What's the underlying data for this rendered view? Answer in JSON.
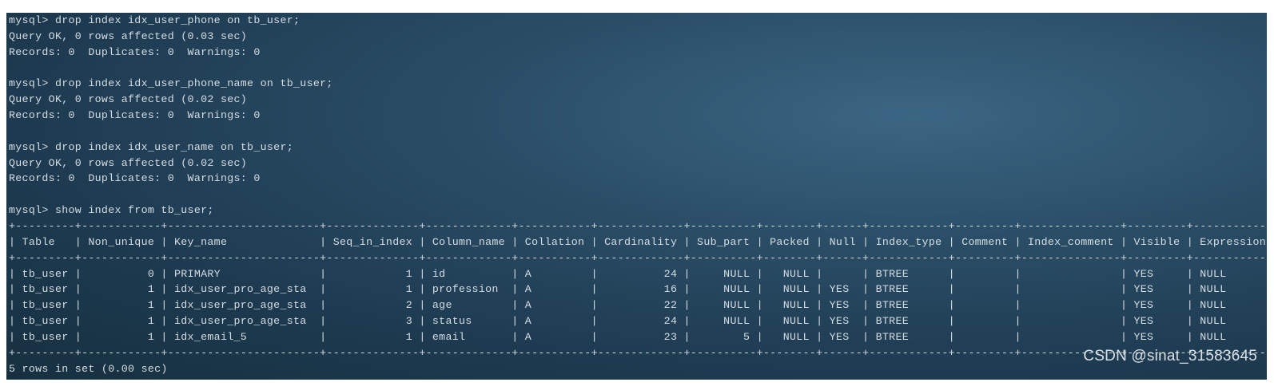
{
  "terminal": {
    "lines": [
      "mysql> drop index idx_user_phone on tb_user;",
      "Query OK, 0 rows affected (0.03 sec)",
      "Records: 0  Duplicates: 0  Warnings: 0",
      "",
      "mysql> drop index idx_user_phone_name on tb_user;",
      "Query OK, 0 rows affected (0.02 sec)",
      "Records: 0  Duplicates: 0  Warnings: 0",
      "",
      "mysql> drop index idx_user_name on tb_user;",
      "Query OK, 0 rows affected (0.02 sec)",
      "Records: 0  Duplicates: 0  Warnings: 0",
      "",
      "mysql> show index from tb_user;",
      "+---------+------------+-----------------------+--------------+-------------+-----------+-------------+----------+--------+------+------------+---------+---------------+---------+------------+",
      "| Table   | Non_unique | Key_name              | Seq_in_index | Column_name | Collation | Cardinality | Sub_part | Packed | Null | Index_type | Comment | Index_comment | Visible | Expression |",
      "+---------+------------+-----------------------+--------------+-------------+-----------+-------------+----------+--------+------+------------+---------+---------------+---------+------------+",
      "| tb_user |          0 | PRIMARY               |            1 | id          | A         |          24 |     NULL |   NULL |      | BTREE      |         |               | YES     | NULL       |",
      "| tb_user |          1 | idx_user_pro_age_sta  |            1 | profession  | A         |          16 |     NULL |   NULL | YES  | BTREE      |         |               | YES     | NULL       |",
      "| tb_user |          1 | idx_user_pro_age_sta  |            2 | age         | A         |          22 |     NULL |   NULL | YES  | BTREE      |         |               | YES     | NULL       |",
      "| tb_user |          1 | idx_user_pro_age_sta  |            3 | status      | A         |          24 |     NULL |   NULL | YES  | BTREE      |         |               | YES     | NULL       |",
      "| tb_user |          1 | idx_email_5           |            1 | email       | A         |          23 |        5 |   NULL | YES  | BTREE      |         |               | YES     | NULL       |",
      "+---------+------------+-----------------------+--------------+-------------+-----------+-------------+----------+--------+------+------------+---------+---------------+---------+------------+",
      "5 rows in set (0.00 sec)"
    ]
  },
  "watermark": {
    "text": "CSDN @sinat_31583645"
  }
}
